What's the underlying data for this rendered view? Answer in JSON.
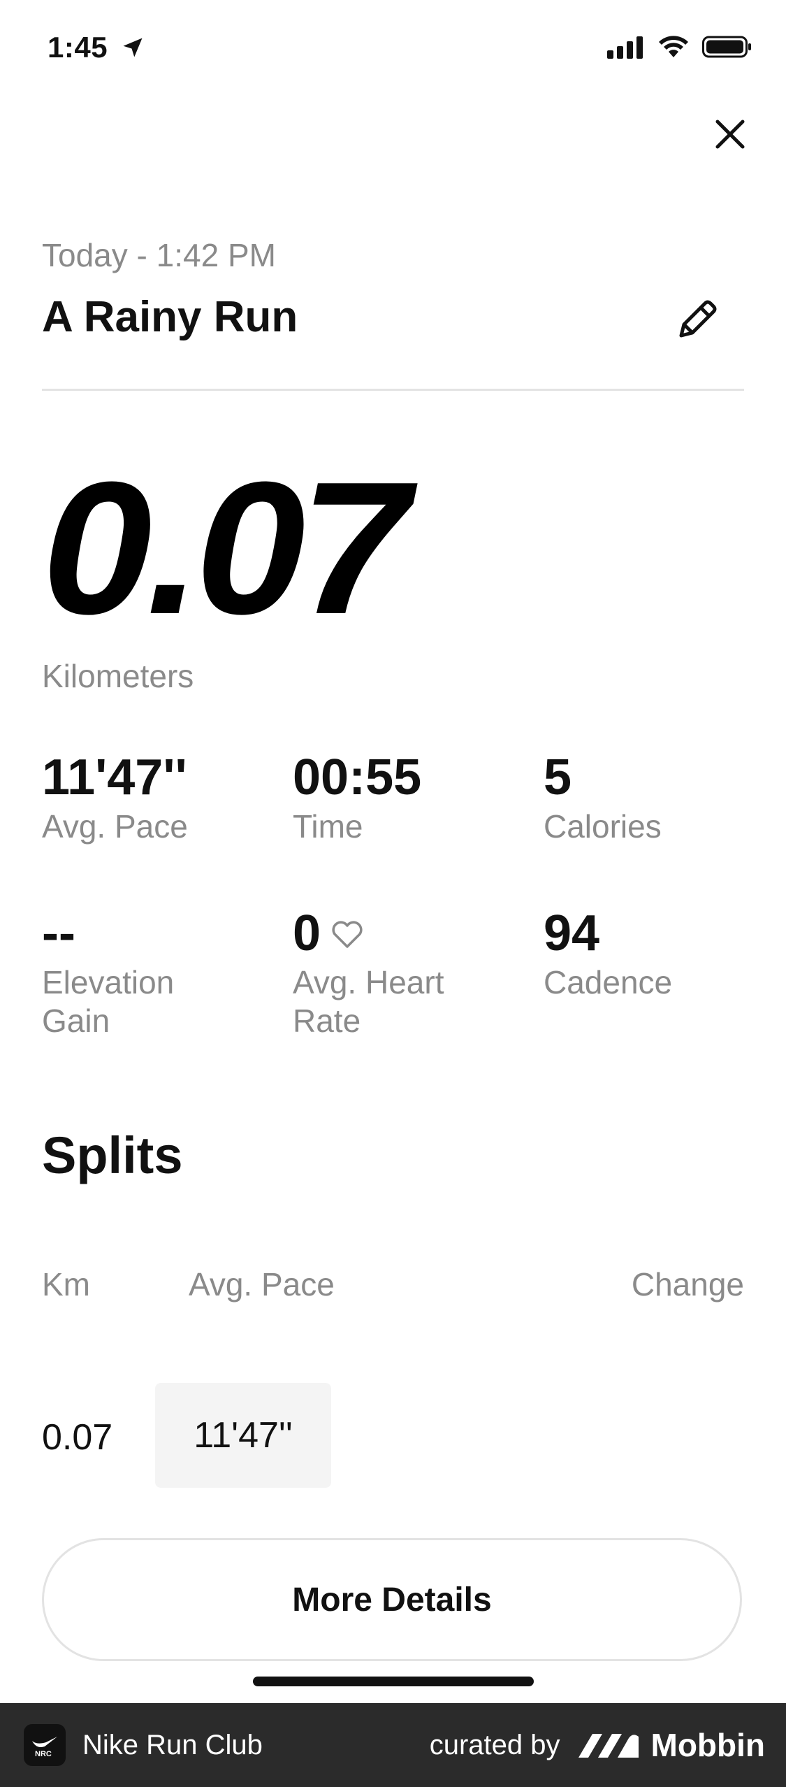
{
  "status": {
    "time": "1:45"
  },
  "header": {
    "date": "Today - 1:42 PM",
    "title": "A Rainy Run"
  },
  "summary": {
    "distance": "0.07",
    "unit": "Kilometers"
  },
  "stats": [
    {
      "value": "11'47''",
      "label": "Avg. Pace"
    },
    {
      "value": "00:55",
      "label": "Time"
    },
    {
      "value": "5",
      "label": "Calories"
    },
    {
      "value": "--",
      "label": "Elevation Gain"
    },
    {
      "value": "0",
      "label": "Avg. Heart Rate"
    },
    {
      "value": "94",
      "label": "Cadence"
    }
  ],
  "splits": {
    "heading": "Splits",
    "columns": {
      "km": "Km",
      "pace": "Avg. Pace",
      "change": "Change"
    },
    "rows": [
      {
        "km": "0.07",
        "pace": "11'47''"
      }
    ]
  },
  "actions": {
    "more_details": "More Details"
  },
  "footer": {
    "app_name": "Nike Run Club",
    "curated_by": "curated by",
    "brand": "Mobbin",
    "app_icon_text": "NRC"
  }
}
